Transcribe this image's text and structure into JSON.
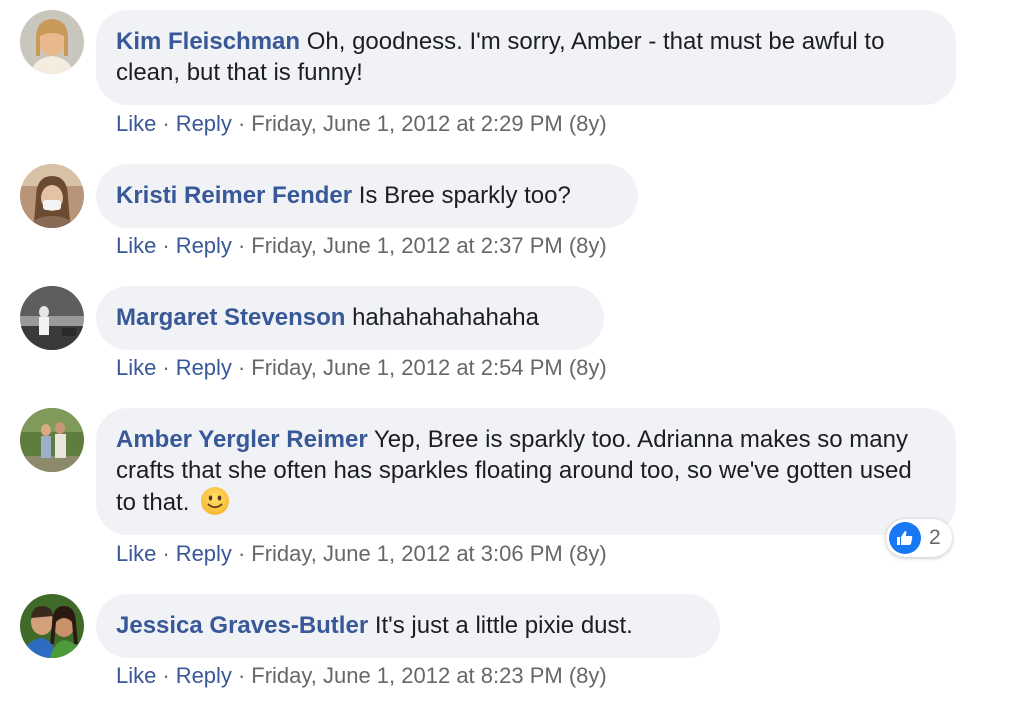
{
  "actions": {
    "like": "Like",
    "reply": "Reply",
    "sep": "·"
  },
  "comments": [
    {
      "author": "Kim Fleischman",
      "text": "Oh, goodness. I'm sorry, Amber - that must be awful to clean, but that is funny!",
      "timestamp": "Friday, June 1, 2012 at 2:29 PM (8y)"
    },
    {
      "author": "Kristi Reimer Fender",
      "text": "Is Bree sparkly too?",
      "timestamp": "Friday, June 1, 2012 at 2:37 PM (8y)"
    },
    {
      "author": "Margaret Stevenson",
      "text": "hahahahahahaha",
      "timestamp": "Friday, June 1, 2012 at 2:54 PM (8y)"
    },
    {
      "author": "Amber Yergler Reimer",
      "text": "Yep, Bree is sparkly too. Adrianna makes so many crafts that she often has sparkles floating around too, so we've gotten used to that.",
      "timestamp": "Friday, June 1, 2012 at 3:06 PM (8y)",
      "emoji": "slightly-smiling-face-icon",
      "reaction": {
        "icon": "like-icon",
        "count": "2",
        "color": "#1877f2"
      }
    },
    {
      "author": "Jessica Graves-Butler",
      "text": "It's just a little pixie dust.",
      "timestamp": "Friday, June 1, 2012 at 8:23 PM (8y)"
    }
  ],
  "colors": {
    "author": "#385898",
    "bubble": "#f0f2f5",
    "meta": "#65676b",
    "like_blue": "#1877f2"
  }
}
